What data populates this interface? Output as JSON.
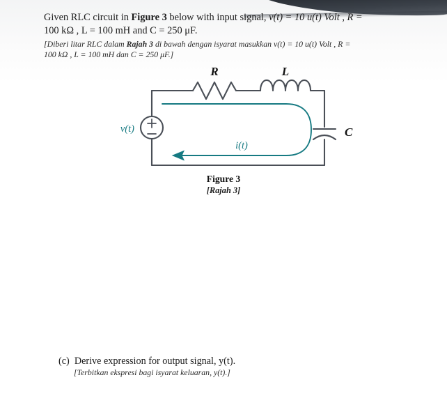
{
  "document": {
    "background_color": "#ffffff",
    "accent_color": "#167a82",
    "wire_color": "#4a4f57"
  },
  "header": {
    "english": {
      "part1": "Given RLC circuit in ",
      "figure_ref": "Figure 3",
      "part2": " below with input signal, ",
      "formula1": "v(t) = 10 u(t) Volt , R =",
      "line2": "100 kΩ , L = 100 mH and C = 250 μF."
    },
    "malay": {
      "part1": "[Diberi litar RLC dalam ",
      "figure_ref": "Rajah 3",
      "part2": " di bawah dengan isyarat masukkan ",
      "formula1": "v(t) = 10 u(t) Volt , R =",
      "line2": "100 kΩ , L = 100 mH dan C = 250 μF.]"
    }
  },
  "figure": {
    "labels": {
      "resistor": "R",
      "inductor": "L",
      "capacitor": "C",
      "source": "v(t)",
      "current": "i(t)",
      "source_plus": "+",
      "source_minus": "−"
    },
    "caption_main": "Figure 3",
    "caption_sub": "[Rajah 3]",
    "circuit_type": "series RLC circuit with independent voltage source",
    "components": [
      {
        "name": "voltage-source",
        "label": "v(t)",
        "position": "left-branch"
      },
      {
        "name": "resistor",
        "label": "R",
        "position": "top-left"
      },
      {
        "name": "inductor",
        "label": "L",
        "position": "top-right"
      },
      {
        "name": "capacitor",
        "label": "C",
        "position": "right-branch"
      }
    ],
    "current_direction": "counter-clockwise (arrow pointing left)"
  },
  "question": {
    "marker": "(c)",
    "english": "Derive expression for output signal, y(t).",
    "english_math": "y(t)",
    "english_pre": "Derive expression for output signal, ",
    "english_post": ".",
    "malay": "[Terbitkan ekspresi bagi isyarat keluaran, y(t).]"
  }
}
